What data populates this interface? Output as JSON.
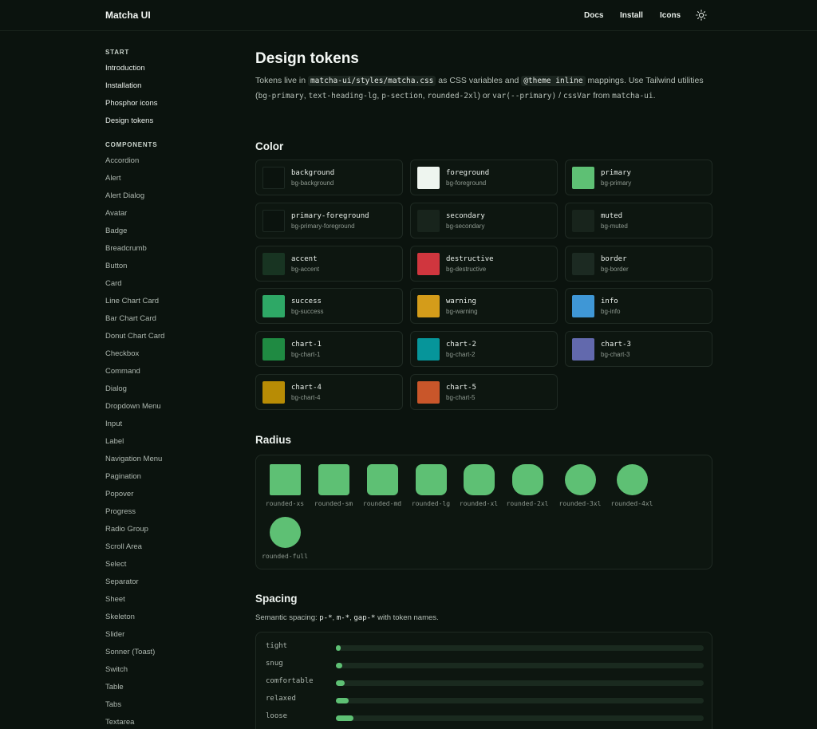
{
  "header": {
    "brand": "Matcha UI",
    "nav": [
      "Docs",
      "Install",
      "Icons"
    ],
    "theme_icon": "sun-icon"
  },
  "sidebar": {
    "start_title": "START",
    "start_items": [
      "Introduction",
      "Installation",
      "Phosphor icons",
      "Design tokens"
    ],
    "components_title": "COMPONENTS",
    "component_items": [
      "Accordion",
      "Alert",
      "Alert Dialog",
      "Avatar",
      "Badge",
      "Breadcrumb",
      "Button",
      "Card",
      "Line Chart Card",
      "Bar Chart Card",
      "Donut Chart Card",
      "Checkbox",
      "Command",
      "Dialog",
      "Dropdown Menu",
      "Input",
      "Label",
      "Navigation Menu",
      "Pagination",
      "Popover",
      "Progress",
      "Radio Group",
      "Scroll Area",
      "Select",
      "Separator",
      "Sheet",
      "Skeleton",
      "Slider",
      "Sonner (Toast)",
      "Switch",
      "Table",
      "Tabs",
      "Textarea"
    ]
  },
  "main": {
    "title": "Design tokens",
    "lead": {
      "t1": "Tokens live in ",
      "c1": "matcha-ui/styles/matcha.css",
      "t2": " as CSS variables and ",
      "c2": "@theme inline",
      "t3": " mappings. Use Tailwind utilities (",
      "c3": "bg-primary",
      "t4": ", ",
      "c4": "text-heading-lg",
      "t5": ", ",
      "c5": "p-section",
      "t6": ", ",
      "c6": "rounded-2xl",
      "t7": ") or ",
      "c7": "var(--primary)",
      "t8": " / ",
      "c8": "cssVar",
      "t9": " from ",
      "c9": "matcha-ui",
      "t10": "."
    },
    "color_title": "Color",
    "colors": [
      {
        "name": "background",
        "cls": "bg-background",
        "hex": "#0b130e"
      },
      {
        "name": "foreground",
        "cls": "bg-foreground",
        "hex": "#eef5ef"
      },
      {
        "name": "primary",
        "cls": "bg-primary",
        "hex": "#5ec074"
      },
      {
        "name": "primary-foreground",
        "cls": "bg-primary-foreground",
        "hex": "#0b130e"
      },
      {
        "name": "secondary",
        "cls": "bg-secondary",
        "hex": "#18241c"
      },
      {
        "name": "muted",
        "cls": "bg-muted",
        "hex": "#18241c"
      },
      {
        "name": "accent",
        "cls": "bg-accent",
        "hex": "#183422"
      },
      {
        "name": "destructive",
        "cls": "bg-destructive",
        "hex": "#d0363e"
      },
      {
        "name": "border",
        "cls": "bg-border",
        "hex": "#1c2a22"
      },
      {
        "name": "success",
        "cls": "bg-success",
        "hex": "#2ea866"
      },
      {
        "name": "warning",
        "cls": "bg-warning",
        "hex": "#d49c1a"
      },
      {
        "name": "info",
        "cls": "bg-info",
        "hex": "#3f97d6"
      },
      {
        "name": "chart-1",
        "cls": "bg-chart-1",
        "hex": "#1f8a42"
      },
      {
        "name": "chart-2",
        "cls": "bg-chart-2",
        "hex": "#06959a"
      },
      {
        "name": "chart-3",
        "cls": "bg-chart-3",
        "hex": "#6269ad"
      },
      {
        "name": "chart-4",
        "cls": "bg-chart-4",
        "hex": "#b88c05"
      },
      {
        "name": "chart-5",
        "cls": "bg-chart-5",
        "hex": "#c9562a"
      }
    ],
    "radius_title": "Radius",
    "radii": [
      {
        "label": "rounded-xs",
        "r": "2px"
      },
      {
        "label": "rounded-sm",
        "r": "4px"
      },
      {
        "label": "rounded-md",
        "r": "6px"
      },
      {
        "label": "rounded-lg",
        "r": "8px"
      },
      {
        "label": "rounded-xl",
        "r": "12px"
      },
      {
        "label": "rounded-2xl",
        "r": "16px"
      },
      {
        "label": "rounded-3xl",
        "r": "24px"
      },
      {
        "label": "rounded-4xl",
        "r": "32px"
      },
      {
        "label": "rounded-full",
        "r": "50%"
      }
    ],
    "spacing_title": "Spacing",
    "spacing_desc": {
      "t1": "Semantic spacing: ",
      "c1": "p-*",
      "t2": ", ",
      "c2": "m-*",
      "t3": ", ",
      "c3": "gap-*",
      "t4": " with token names."
    },
    "spacing": [
      {
        "label": "tight",
        "fill": 0.011
      },
      {
        "label": "snug",
        "fill": 0.017
      },
      {
        "label": "comfortable",
        "fill": 0.024
      },
      {
        "label": "relaxed",
        "fill": 0.035
      },
      {
        "label": "loose",
        "fill": 0.048
      }
    ]
  }
}
